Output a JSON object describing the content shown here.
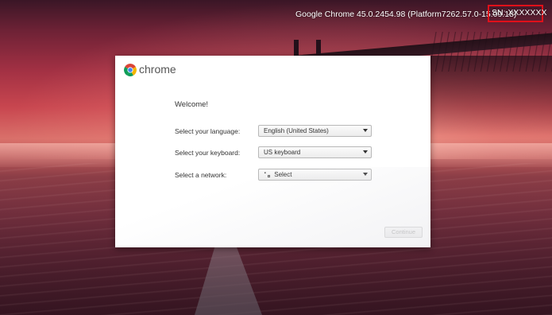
{
  "system": {
    "version_text": "Google Chrome 45.0.2454.98 (Platform7262.57.0-15.09.18)",
    "serial_text": "SN: XXXXXXX"
  },
  "dialog": {
    "brand": "chrome",
    "welcome": "Welcome!",
    "language": {
      "label": "Select your language:",
      "value": "English (United States)"
    },
    "keyboard": {
      "label": "Select your keyboard:",
      "value": "US keyboard"
    },
    "network": {
      "label": "Select a network:",
      "value": "Select"
    },
    "continue_label": "Continue",
    "continue_state": "disabled"
  },
  "colors": {
    "highlight_border": "#e0101a",
    "chrome_red": "#db4437",
    "chrome_yellow": "#f4b400",
    "chrome_green": "#0f9d58",
    "chrome_blue": "#4285f4"
  },
  "icons": [
    "chrome-logo-icon",
    "dropdown-arrow-icon",
    "network-signal-icon"
  ]
}
